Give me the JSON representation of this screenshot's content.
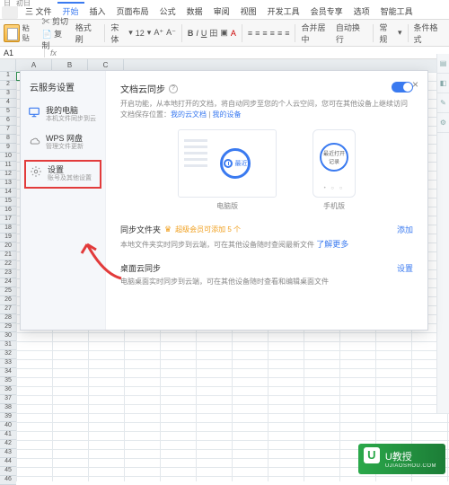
{
  "top": {
    "items": [
      "日",
      "初日",
      "-",
      "v"
    ]
  },
  "tabs": {
    "file": "三 文件",
    "items": [
      "开始",
      "插入",
      "页面布局",
      "公式",
      "数据",
      "审阅",
      "视图",
      "开发工具",
      "会员专享",
      "选项",
      "智能工具"
    ],
    "active": 0
  },
  "ribbon": {
    "paste": "粘贴",
    "cut": "剪切",
    "copy": "复制",
    "fmtbrush": "格式刷",
    "font": "宋体",
    "size": "12",
    "mergecenter": "合并居中",
    "wrap": "自动换行",
    "general": "常规",
    "condfmt": "条件格式"
  },
  "namebox": "A1",
  "fx": "fx",
  "cols": [
    "A",
    "B",
    "C"
  ],
  "rows_start": 1,
  "rows_end": 46,
  "modal": {
    "title": "云服务设置",
    "side": {
      "pc": {
        "label": "我的电脑",
        "sub": "本机文件同步到云"
      },
      "wps": {
        "label": "WPS 网盘",
        "sub": "管理文件更新"
      },
      "settings": {
        "label": "设置",
        "sub": "账号及其他设置"
      }
    },
    "main": {
      "doc_sync": "文档云同步",
      "desc1": "开启功能，从本地打开的文档，将自动同步至您的个人云空间，您可在其他设备上继续访问",
      "desc2_pre": "文档保存位置：",
      "desc2_link1": "我的云文档",
      "desc2_sep": " | ",
      "desc2_link2": "我的设备",
      "pc_label": "电脑版",
      "phone_label": "手机版",
      "recent": "最近",
      "phone_text": "最近打开记录",
      "folder_sync": "同步文件夹",
      "crown_text": "超级会员可添加 5 个",
      "add": "添加",
      "folder_desc": "本地文件夹实时同步到云端，可在其他设备随时查阅最新文件",
      "learn_more": "了解更多",
      "desktop_sync": "桌面云同步",
      "set": "设置",
      "desktop_desc": "电脑桌面实时同步到云端，可在其他设备随时查看和编辑桌面文件"
    }
  },
  "watermark": {
    "brand": "U教授",
    "url": "UJIAOSHOU.COM"
  }
}
